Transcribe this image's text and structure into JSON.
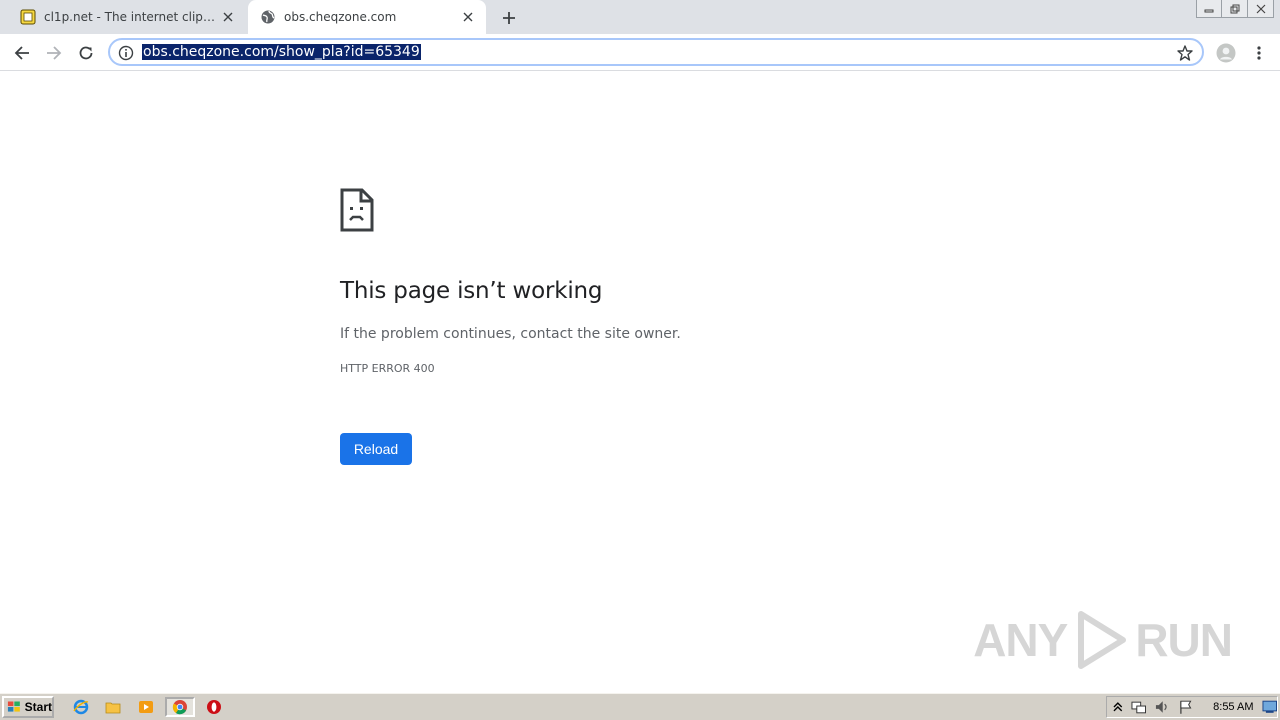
{
  "tabs": [
    {
      "title": "cl1p.net - The internet clipboard",
      "favicon": "cl1p-favicon",
      "active": false
    },
    {
      "title": "obs.cheqzone.com",
      "favicon": "globe-icon",
      "active": true
    }
  ],
  "omnibox": {
    "url": "obs.cheqzone.com/show_pla?id=65349"
  },
  "error": {
    "title": "This page isn’t working",
    "message": "If the problem continues, contact the site owner.",
    "code": "HTTP ERROR 400",
    "reload_label": "Reload"
  },
  "watermark": {
    "text_left": "ANY",
    "text_right": "RUN"
  },
  "taskbar": {
    "start_label": "Start",
    "clock": "8:55 AM"
  },
  "colors": {
    "accent": "#1a73e8",
    "url_highlight": "#0a246a",
    "tabstrip": "#dee1e6",
    "taskbar": "#d4d0c8"
  }
}
